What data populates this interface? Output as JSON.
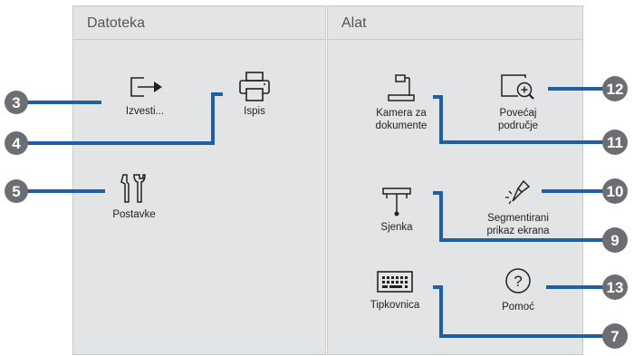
{
  "panels": {
    "file": {
      "title": "Datoteka",
      "items": {
        "export": "Izvesti...",
        "print": "Ispis",
        "settings": "Postavke"
      }
    },
    "tools": {
      "title": "Alat",
      "items": {
        "document_camera": "Kamera za\ndokumente",
        "zoom": "Povećaj\npodručje",
        "shade": "Sjenka",
        "spotlight": "Segmentirani\nprikaz ekrana",
        "keyboard": "Tipkovnica",
        "help": "Pomoć"
      }
    }
  },
  "callouts": {
    "c3": "3",
    "c4": "4",
    "c5": "5",
    "c7": "7",
    "c9": "9",
    "c10": "10",
    "c11": "11",
    "c12": "12",
    "c13": "13"
  },
  "colors": {
    "callout": "#6d6e71",
    "line": "#1f5fa6",
    "panel": "#e3e4e6"
  }
}
